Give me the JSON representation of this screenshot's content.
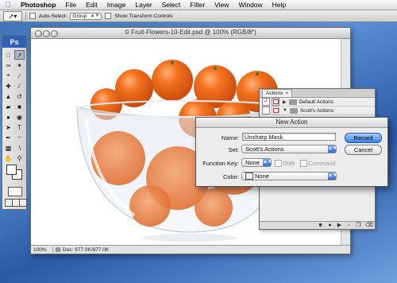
{
  "menubar": {
    "items": [
      "Photoshop",
      "File",
      "Edit",
      "Image",
      "Layer",
      "Select",
      "Filter",
      "View",
      "Window",
      "Help"
    ]
  },
  "options_bar": {
    "auto_select_label": "Auto-Select:",
    "auto_select_value": "Group",
    "transform_label": "Show Transform Controls"
  },
  "toolbox": {
    "logo": "Ps"
  },
  "document": {
    "title": "© Fruit-Flowers-10-Edit.psd @ 100% (RGB/8*)",
    "zoom": "100%",
    "doc_size": "Doc: 977.0K/977.0K"
  },
  "actions_panel": {
    "tab_label": "Actions",
    "sets": [
      {
        "name": "Default Actions",
        "expanded": false,
        "checked": true
      },
      {
        "name": "Scott's Actions",
        "expanded": true,
        "checked": false
      }
    ]
  },
  "dialog": {
    "title": "New Action",
    "name_label": "Name:",
    "name_value": "Unsharp Mask",
    "set_label": "Set:",
    "set_value": "Scott's Actions",
    "fkey_label": "Function Key:",
    "fkey_value": "None",
    "shift_label": "Shift",
    "command_label": "Command",
    "color_label": "Color:",
    "color_value": "None",
    "record_label": "Record",
    "cancel_label": "Cancel"
  },
  "colors": {
    "desktop": "#3d6fb3",
    "accent": "#3b82e6",
    "orange": "#f06a1a"
  }
}
